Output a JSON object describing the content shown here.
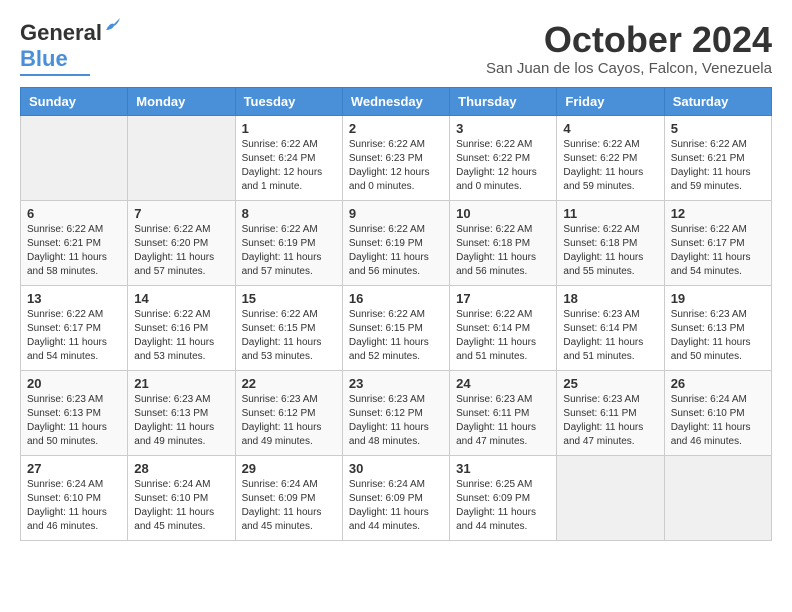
{
  "logo": {
    "general": "General",
    "blue": "Blue"
  },
  "title": "October 2024",
  "subtitle": "San Juan de los Cayos, Falcon, Venezuela",
  "days_of_week": [
    "Sunday",
    "Monday",
    "Tuesday",
    "Wednesday",
    "Thursday",
    "Friday",
    "Saturday"
  ],
  "weeks": [
    [
      {
        "day": "",
        "info": ""
      },
      {
        "day": "",
        "info": ""
      },
      {
        "day": "1",
        "info": "Sunrise: 6:22 AM\nSunset: 6:24 PM\nDaylight: 12 hours and 1 minute."
      },
      {
        "day": "2",
        "info": "Sunrise: 6:22 AM\nSunset: 6:23 PM\nDaylight: 12 hours and 0 minutes."
      },
      {
        "day": "3",
        "info": "Sunrise: 6:22 AM\nSunset: 6:22 PM\nDaylight: 12 hours and 0 minutes."
      },
      {
        "day": "4",
        "info": "Sunrise: 6:22 AM\nSunset: 6:22 PM\nDaylight: 11 hours and 59 minutes."
      },
      {
        "day": "5",
        "info": "Sunrise: 6:22 AM\nSunset: 6:21 PM\nDaylight: 11 hours and 59 minutes."
      }
    ],
    [
      {
        "day": "6",
        "info": "Sunrise: 6:22 AM\nSunset: 6:21 PM\nDaylight: 11 hours and 58 minutes."
      },
      {
        "day": "7",
        "info": "Sunrise: 6:22 AM\nSunset: 6:20 PM\nDaylight: 11 hours and 57 minutes."
      },
      {
        "day": "8",
        "info": "Sunrise: 6:22 AM\nSunset: 6:19 PM\nDaylight: 11 hours and 57 minutes."
      },
      {
        "day": "9",
        "info": "Sunrise: 6:22 AM\nSunset: 6:19 PM\nDaylight: 11 hours and 56 minutes."
      },
      {
        "day": "10",
        "info": "Sunrise: 6:22 AM\nSunset: 6:18 PM\nDaylight: 11 hours and 56 minutes."
      },
      {
        "day": "11",
        "info": "Sunrise: 6:22 AM\nSunset: 6:18 PM\nDaylight: 11 hours and 55 minutes."
      },
      {
        "day": "12",
        "info": "Sunrise: 6:22 AM\nSunset: 6:17 PM\nDaylight: 11 hours and 54 minutes."
      }
    ],
    [
      {
        "day": "13",
        "info": "Sunrise: 6:22 AM\nSunset: 6:17 PM\nDaylight: 11 hours and 54 minutes."
      },
      {
        "day": "14",
        "info": "Sunrise: 6:22 AM\nSunset: 6:16 PM\nDaylight: 11 hours and 53 minutes."
      },
      {
        "day": "15",
        "info": "Sunrise: 6:22 AM\nSunset: 6:15 PM\nDaylight: 11 hours and 53 minutes."
      },
      {
        "day": "16",
        "info": "Sunrise: 6:22 AM\nSunset: 6:15 PM\nDaylight: 11 hours and 52 minutes."
      },
      {
        "day": "17",
        "info": "Sunrise: 6:22 AM\nSunset: 6:14 PM\nDaylight: 11 hours and 51 minutes."
      },
      {
        "day": "18",
        "info": "Sunrise: 6:23 AM\nSunset: 6:14 PM\nDaylight: 11 hours and 51 minutes."
      },
      {
        "day": "19",
        "info": "Sunrise: 6:23 AM\nSunset: 6:13 PM\nDaylight: 11 hours and 50 minutes."
      }
    ],
    [
      {
        "day": "20",
        "info": "Sunrise: 6:23 AM\nSunset: 6:13 PM\nDaylight: 11 hours and 50 minutes."
      },
      {
        "day": "21",
        "info": "Sunrise: 6:23 AM\nSunset: 6:13 PM\nDaylight: 11 hours and 49 minutes."
      },
      {
        "day": "22",
        "info": "Sunrise: 6:23 AM\nSunset: 6:12 PM\nDaylight: 11 hours and 49 minutes."
      },
      {
        "day": "23",
        "info": "Sunrise: 6:23 AM\nSunset: 6:12 PM\nDaylight: 11 hours and 48 minutes."
      },
      {
        "day": "24",
        "info": "Sunrise: 6:23 AM\nSunset: 6:11 PM\nDaylight: 11 hours and 47 minutes."
      },
      {
        "day": "25",
        "info": "Sunrise: 6:23 AM\nSunset: 6:11 PM\nDaylight: 11 hours and 47 minutes."
      },
      {
        "day": "26",
        "info": "Sunrise: 6:24 AM\nSunset: 6:10 PM\nDaylight: 11 hours and 46 minutes."
      }
    ],
    [
      {
        "day": "27",
        "info": "Sunrise: 6:24 AM\nSunset: 6:10 PM\nDaylight: 11 hours and 46 minutes."
      },
      {
        "day": "28",
        "info": "Sunrise: 6:24 AM\nSunset: 6:10 PM\nDaylight: 11 hours and 45 minutes."
      },
      {
        "day": "29",
        "info": "Sunrise: 6:24 AM\nSunset: 6:09 PM\nDaylight: 11 hours and 45 minutes."
      },
      {
        "day": "30",
        "info": "Sunrise: 6:24 AM\nSunset: 6:09 PM\nDaylight: 11 hours and 44 minutes."
      },
      {
        "day": "31",
        "info": "Sunrise: 6:25 AM\nSunset: 6:09 PM\nDaylight: 11 hours and 44 minutes."
      },
      {
        "day": "",
        "info": ""
      },
      {
        "day": "",
        "info": ""
      }
    ]
  ]
}
